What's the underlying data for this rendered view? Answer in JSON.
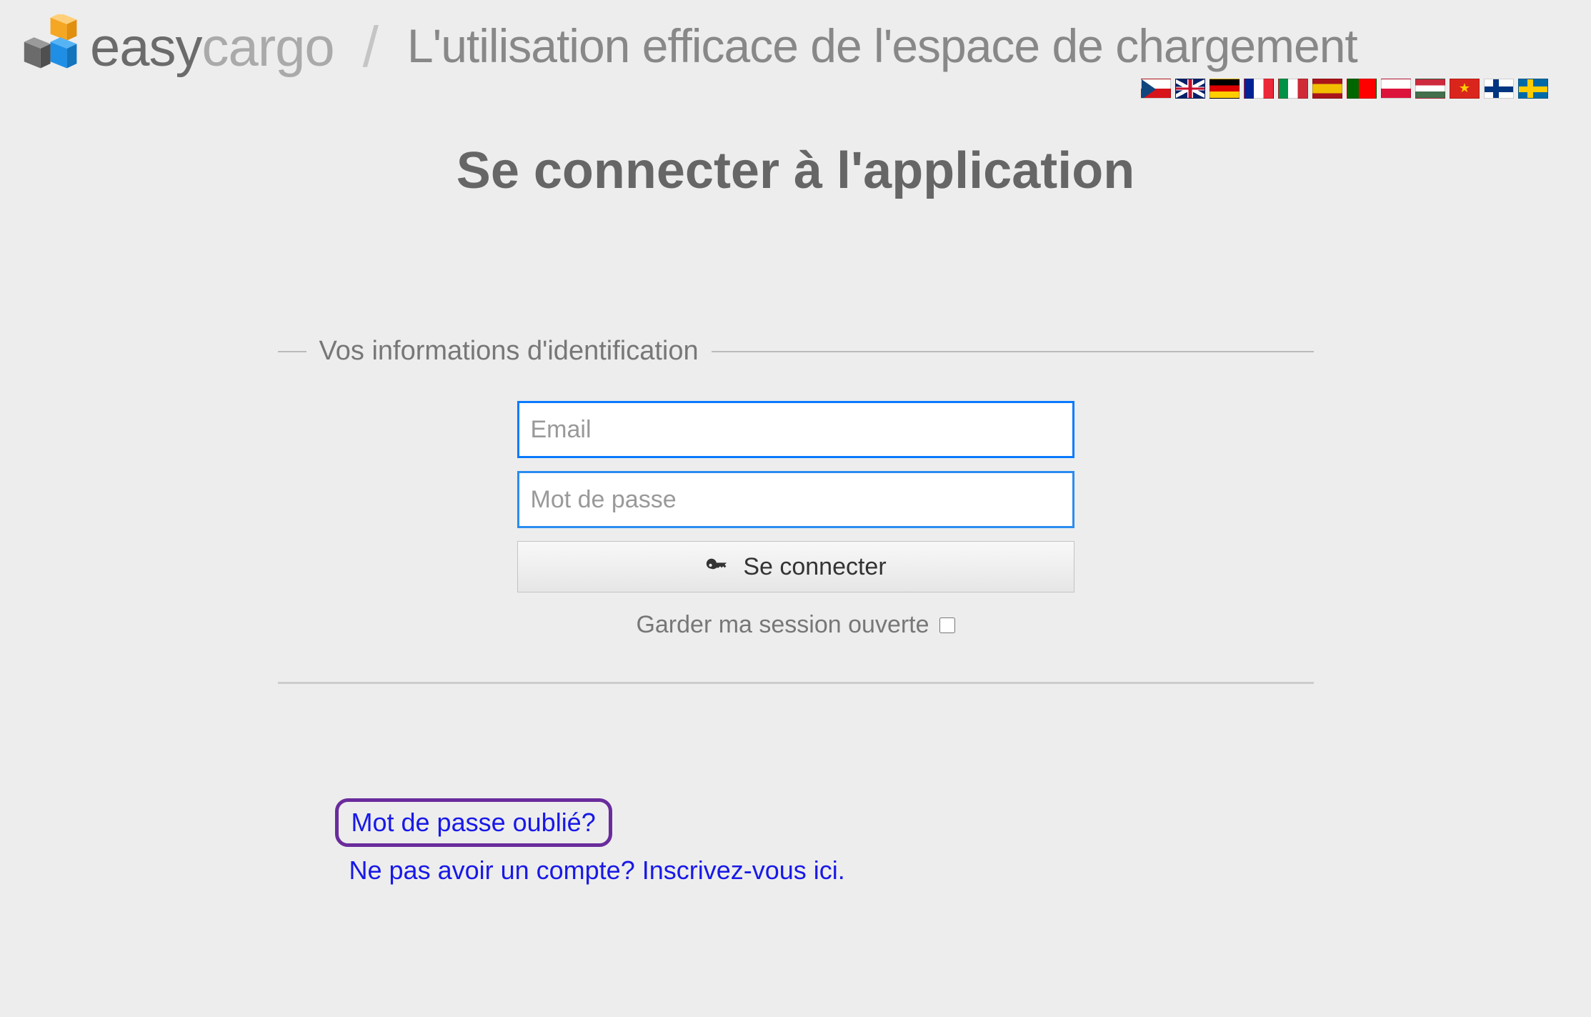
{
  "header": {
    "logo_text_primary": "easy",
    "logo_text_secondary": "cargo",
    "tagline": "L'utilisation efficace de l'espace de chargement",
    "flags": [
      "cz",
      "uk",
      "de",
      "fr",
      "it",
      "es",
      "pt",
      "pl",
      "hu",
      "vn",
      "fi",
      "se"
    ]
  },
  "main": {
    "title": "Se connecter à l'application"
  },
  "form": {
    "legend": "Vos informations d'identification",
    "email_placeholder": "Email",
    "email_value": "",
    "password_placeholder": "Mot de passe",
    "password_value": "",
    "submit_label": "Se connecter",
    "remember_label": "Garder ma session ouverte"
  },
  "links": {
    "forgot": "Mot de passe oublié?",
    "signup": "Ne pas avoir un compte? Inscrivez-vous ici."
  }
}
